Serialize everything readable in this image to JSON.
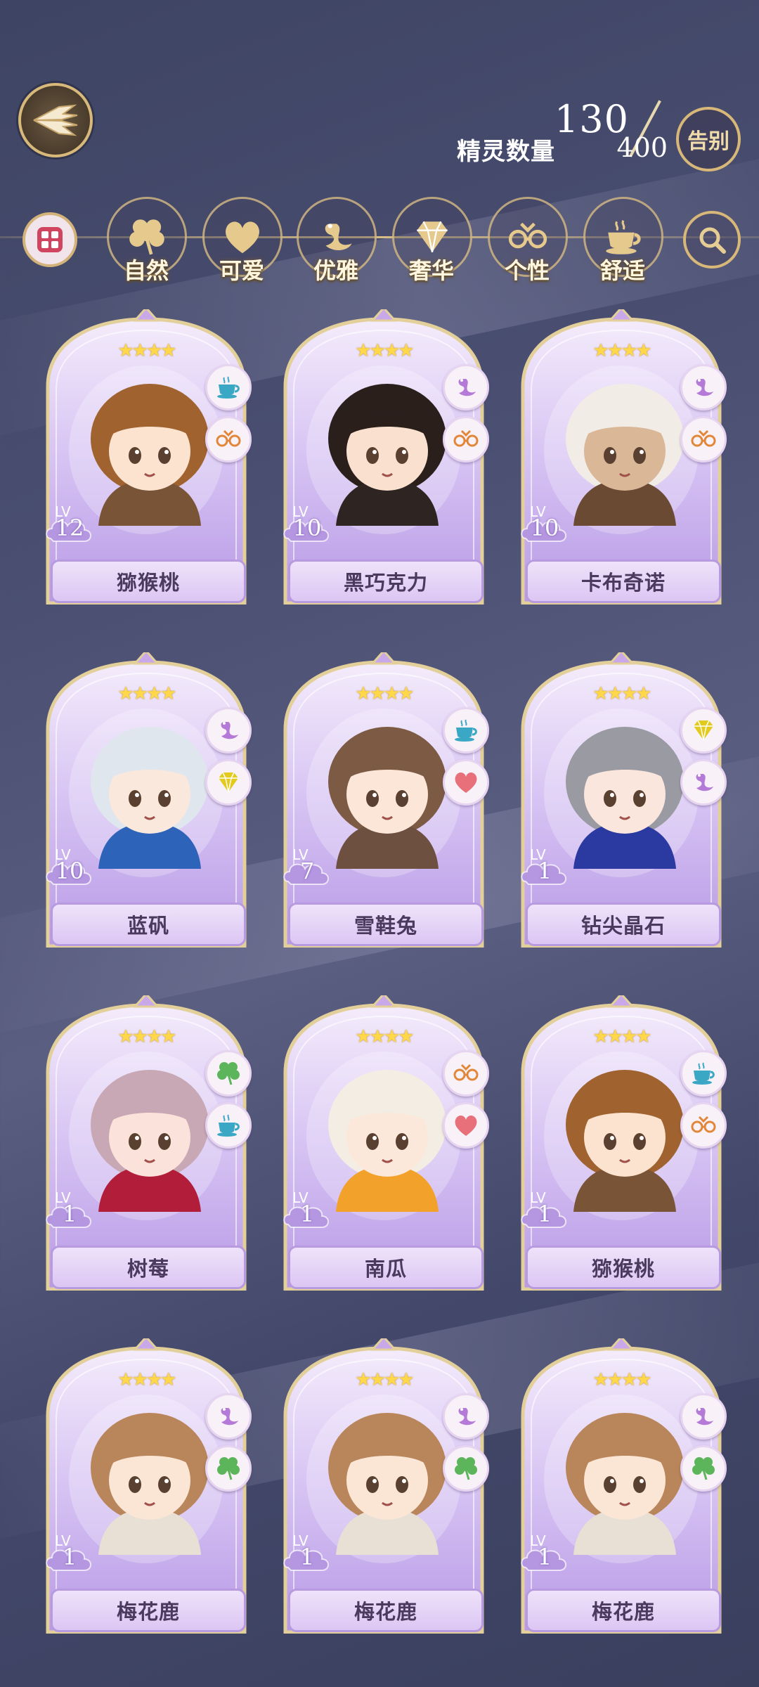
{
  "header": {
    "back_icon": "back-wings-icon",
    "count_label": "精灵数量",
    "count_current": "130",
    "count_max": "400",
    "farewell_label": "告别"
  },
  "filters": {
    "all_icon": "grid-icon",
    "search_icon": "search-icon",
    "items": [
      {
        "label": "自然",
        "icon": "clover-icon"
      },
      {
        "label": "可爱",
        "icon": "heart-icon"
      },
      {
        "label": "优雅",
        "icon": "swan-icon"
      },
      {
        "label": "奢华",
        "icon": "diamond-icon"
      },
      {
        "label": "个性",
        "icon": "glasses-icon"
      },
      {
        "label": "舒适",
        "icon": "teacup-icon"
      }
    ]
  },
  "lv_tag": "LV",
  "stars": "★★★★",
  "colors": {
    "accent_gold": "#d8bd85",
    "card_purple": "#c8b0ee",
    "nameplate_text": "#4b3a5e"
  },
  "cards": [
    {
      "name": "猕猴桃",
      "level": "12",
      "traits": [
        "teacup-icon",
        "glasses-icon"
      ],
      "hair": "#a0622f",
      "skin": "#fbe3d0",
      "outfit": "#7a5436"
    },
    {
      "name": "黑巧克力",
      "level": "10",
      "traits": [
        "swan-icon",
        "glasses-icon"
      ],
      "hair": "#2b1f1c",
      "skin": "#f9e0cf",
      "outfit": "#2e2422"
    },
    {
      "name": "卡布奇诺",
      "level": "10",
      "traits": [
        "swan-icon",
        "glasses-icon"
      ],
      "hair": "#f1ece6",
      "skin": "#d9b797",
      "outfit": "#6b4a34"
    },
    {
      "name": "蓝矾",
      "level": "10",
      "traits": [
        "swan-icon",
        "diamond-icon"
      ],
      "hair": "#dfe6ee",
      "skin": "#fbe8dd",
      "outfit": "#2d63b8"
    },
    {
      "name": "雪鞋兔",
      "level": "7",
      "traits": [
        "teacup-icon",
        "heart-icon"
      ],
      "hair": "#7d5a44",
      "skin": "#fbe6d8",
      "outfit": "#6e5040"
    },
    {
      "name": "钻尖晶石",
      "level": "1",
      "traits": [
        "diamond-icon",
        "swan-icon"
      ],
      "hair": "#9a9aa2",
      "skin": "#fbe6dd",
      "outfit": "#2a3aa0"
    },
    {
      "name": "树莓",
      "level": "1",
      "traits": [
        "clover-icon",
        "teacup-icon"
      ],
      "hair": "#c8a8b4",
      "skin": "#fbe2da",
      "outfit": "#b21e3a"
    },
    {
      "name": "南瓜",
      "level": "1",
      "traits": [
        "glasses-icon",
        "heart-icon"
      ],
      "hair": "#f3ede4",
      "skin": "#fbe8da",
      "outfit": "#f2a12a"
    },
    {
      "name": "猕猴桃",
      "level": "1",
      "traits": [
        "teacup-icon",
        "glasses-icon"
      ],
      "hair": "#a0622f",
      "skin": "#fbe3d0",
      "outfit": "#7a5436"
    },
    {
      "name": "梅花鹿",
      "level": "1",
      "traits": [
        "swan-icon",
        "clover-icon"
      ],
      "hair": "#b9855a",
      "skin": "#fbe6d6",
      "outfit": "#e8e0d4"
    },
    {
      "name": "梅花鹿",
      "level": "1",
      "traits": [
        "swan-icon",
        "clover-icon"
      ],
      "hair": "#b9855a",
      "skin": "#fbe6d6",
      "outfit": "#e8e0d4"
    },
    {
      "name": "梅花鹿",
      "level": "1",
      "traits": [
        "swan-icon",
        "clover-icon"
      ],
      "hair": "#b9855a",
      "skin": "#fbe6d6",
      "outfit": "#e8e0d4"
    }
  ]
}
